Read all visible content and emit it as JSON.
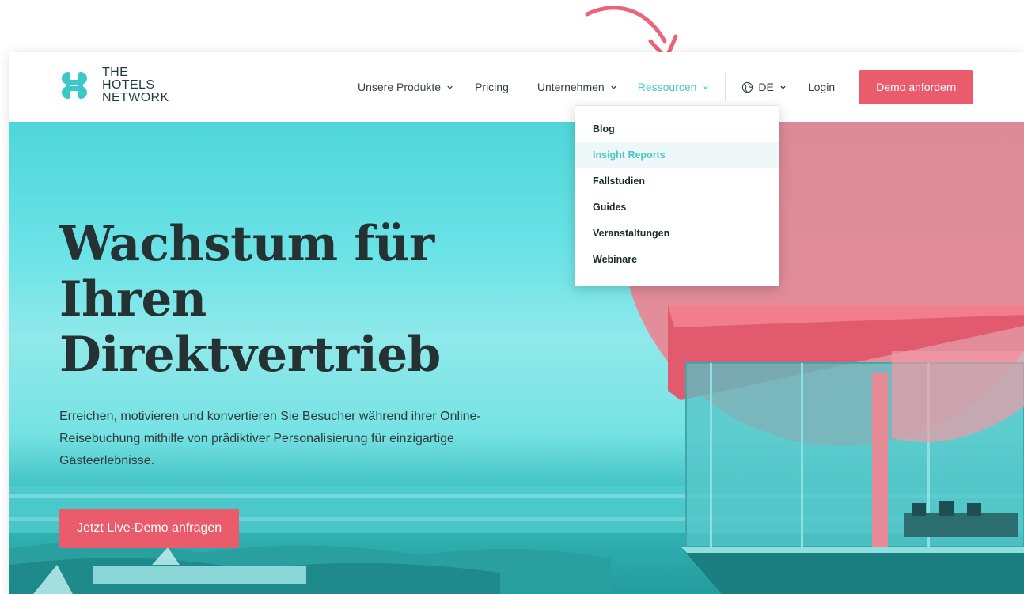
{
  "logo": {
    "line1": "THE",
    "line2": "HOTELS",
    "line3": "NETWORK"
  },
  "nav": {
    "products": "Unsere Produkte",
    "pricing": "Pricing",
    "company": "Unternehmen",
    "resources": "Ressourcen",
    "language": "DE",
    "login": "Login",
    "demo": "Demo anfordern"
  },
  "dropdown": {
    "items": [
      "Blog",
      "Insight Reports",
      "Fallstudien",
      "Guides",
      "Veranstaltungen",
      "Webinare"
    ]
  },
  "hero": {
    "title_line1": "Wachstum für",
    "title_line2": "Ihren",
    "title_line3": "Direktvertrieb",
    "text": "Erreichen, motivieren und konvertieren Sie Besucher während ihrer Online-Reisebuchung mithilfe von prädiktiver Personalisierung für einzigartige Gästeerlebnisse.",
    "cta": "Jetzt Live-Demo anfragen"
  },
  "colors": {
    "accent": "#ea5b6b",
    "teal": "#4cc6c8",
    "annotation": "#ec6477",
    "dark_text": "#263133"
  },
  "icons": [
    "logo-mark-icon",
    "chevron-down-icon",
    "globe-icon",
    "annotation-arrow-icon"
  ]
}
